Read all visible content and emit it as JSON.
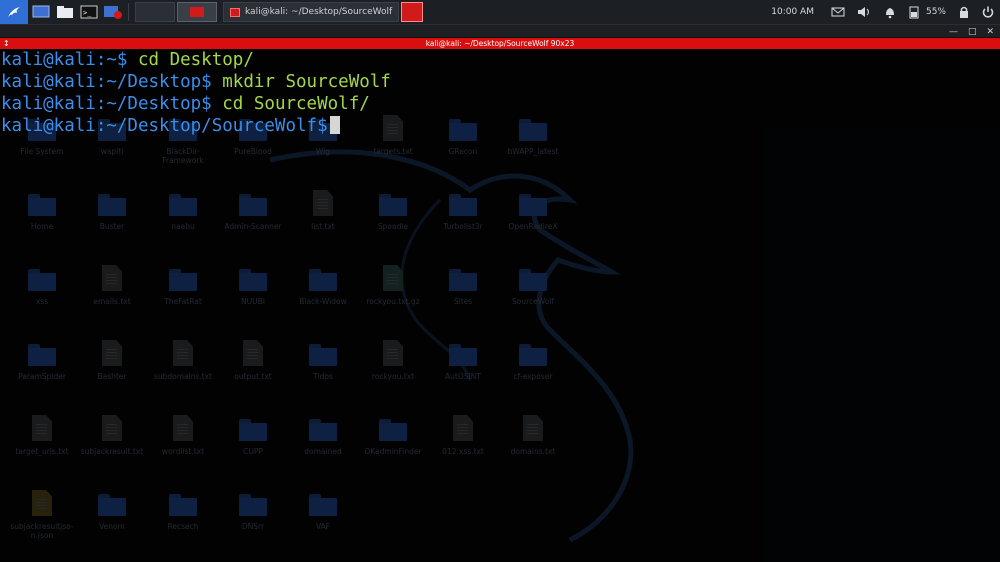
{
  "taskbar": {
    "task_title": "kali@kali: ~/Desktop/SourceWolf",
    "clock": "10:00 AM",
    "battery": "55%"
  },
  "window": {
    "title": "kali@kali: ~/Desktop/SourceWolf 90x23"
  },
  "terminal": {
    "lines": [
      {
        "prompt": "kali@kali:~$ ",
        "command": "cd Desktop/"
      },
      {
        "prompt": "kali@kali:~/Desktop$ ",
        "command": "mkdir SourceWolf"
      },
      {
        "prompt": "kali@kali:~/Desktop$ ",
        "command": "cd SourceWolf/"
      },
      {
        "prompt": "kali@kali:~/Desktop/SourceWolf$",
        "command": ""
      }
    ]
  },
  "desktop": {
    "icons": [
      {
        "label": "File System",
        "kind": "folder"
      },
      {
        "label": "wapiti",
        "kind": "folder"
      },
      {
        "label": "BlackDir-\nFramework",
        "kind": "folder"
      },
      {
        "label": "PureBlood",
        "kind": "folder"
      },
      {
        "label": "Wig",
        "kind": "folder"
      },
      {
        "label": "targets.txt",
        "kind": "file"
      },
      {
        "label": "GRecon",
        "kind": "folder"
      },
      {
        "label": "bWAPP_latest",
        "kind": "folder"
      },
      {
        "label": "Home",
        "kind": "folder"
      },
      {
        "label": "Buster",
        "kind": "folder"
      },
      {
        "label": "naabu",
        "kind": "folder"
      },
      {
        "label": "Admin-Scanner",
        "kind": "folder"
      },
      {
        "label": "list.txt",
        "kind": "file"
      },
      {
        "label": "Spoodle",
        "kind": "folder"
      },
      {
        "label": "Turbolist3r",
        "kind": "folder"
      },
      {
        "label": "OpenRedireX",
        "kind": "folder"
      },
      {
        "label": "xss",
        "kind": "folder"
      },
      {
        "label": "emails.txt",
        "kind": "file"
      },
      {
        "label": "TheFatRat",
        "kind": "folder"
      },
      {
        "label": "NUUBI",
        "kind": "folder"
      },
      {
        "label": "Black-Widow",
        "kind": "folder"
      },
      {
        "label": "rockyou.txt.gz",
        "kind": "gz"
      },
      {
        "label": "Sites",
        "kind": "folder"
      },
      {
        "label": "SourceWolf",
        "kind": "folder"
      },
      {
        "label": "ParamSpider",
        "kind": "folder"
      },
      {
        "label": "Bashter",
        "kind": "file"
      },
      {
        "label": "subdomains.txt",
        "kind": "file"
      },
      {
        "label": "output.txt",
        "kind": "file"
      },
      {
        "label": "Tidos",
        "kind": "folder"
      },
      {
        "label": "rockyou.txt",
        "kind": "file"
      },
      {
        "label": "AutOSINT",
        "kind": "folder"
      },
      {
        "label": "cf-exposer",
        "kind": "folder"
      },
      {
        "label": "target_urls.txt",
        "kind": "file"
      },
      {
        "label": "subjackresult.txt",
        "kind": "file"
      },
      {
        "label": "wordlist.txt",
        "kind": "file"
      },
      {
        "label": "CUPP",
        "kind": "folder"
      },
      {
        "label": "domained",
        "kind": "folder"
      },
      {
        "label": "OKadminFinder",
        "kind": "folder"
      },
      {
        "label": "012.xss.txt",
        "kind": "file"
      },
      {
        "label": "domains.txt",
        "kind": "file"
      },
      {
        "label": "subjackresultjso-\nn.json",
        "kind": "json"
      },
      {
        "label": "Venom",
        "kind": "folder"
      },
      {
        "label": "Recsech",
        "kind": "folder"
      },
      {
        "label": "DNSrr",
        "kind": "folder"
      },
      {
        "label": "VAF",
        "kind": "folder"
      }
    ]
  },
  "colors": {
    "title_red": "#d90f0f",
    "prompt_blue": "#3b8eea",
    "command_green": "#a3d84a"
  }
}
